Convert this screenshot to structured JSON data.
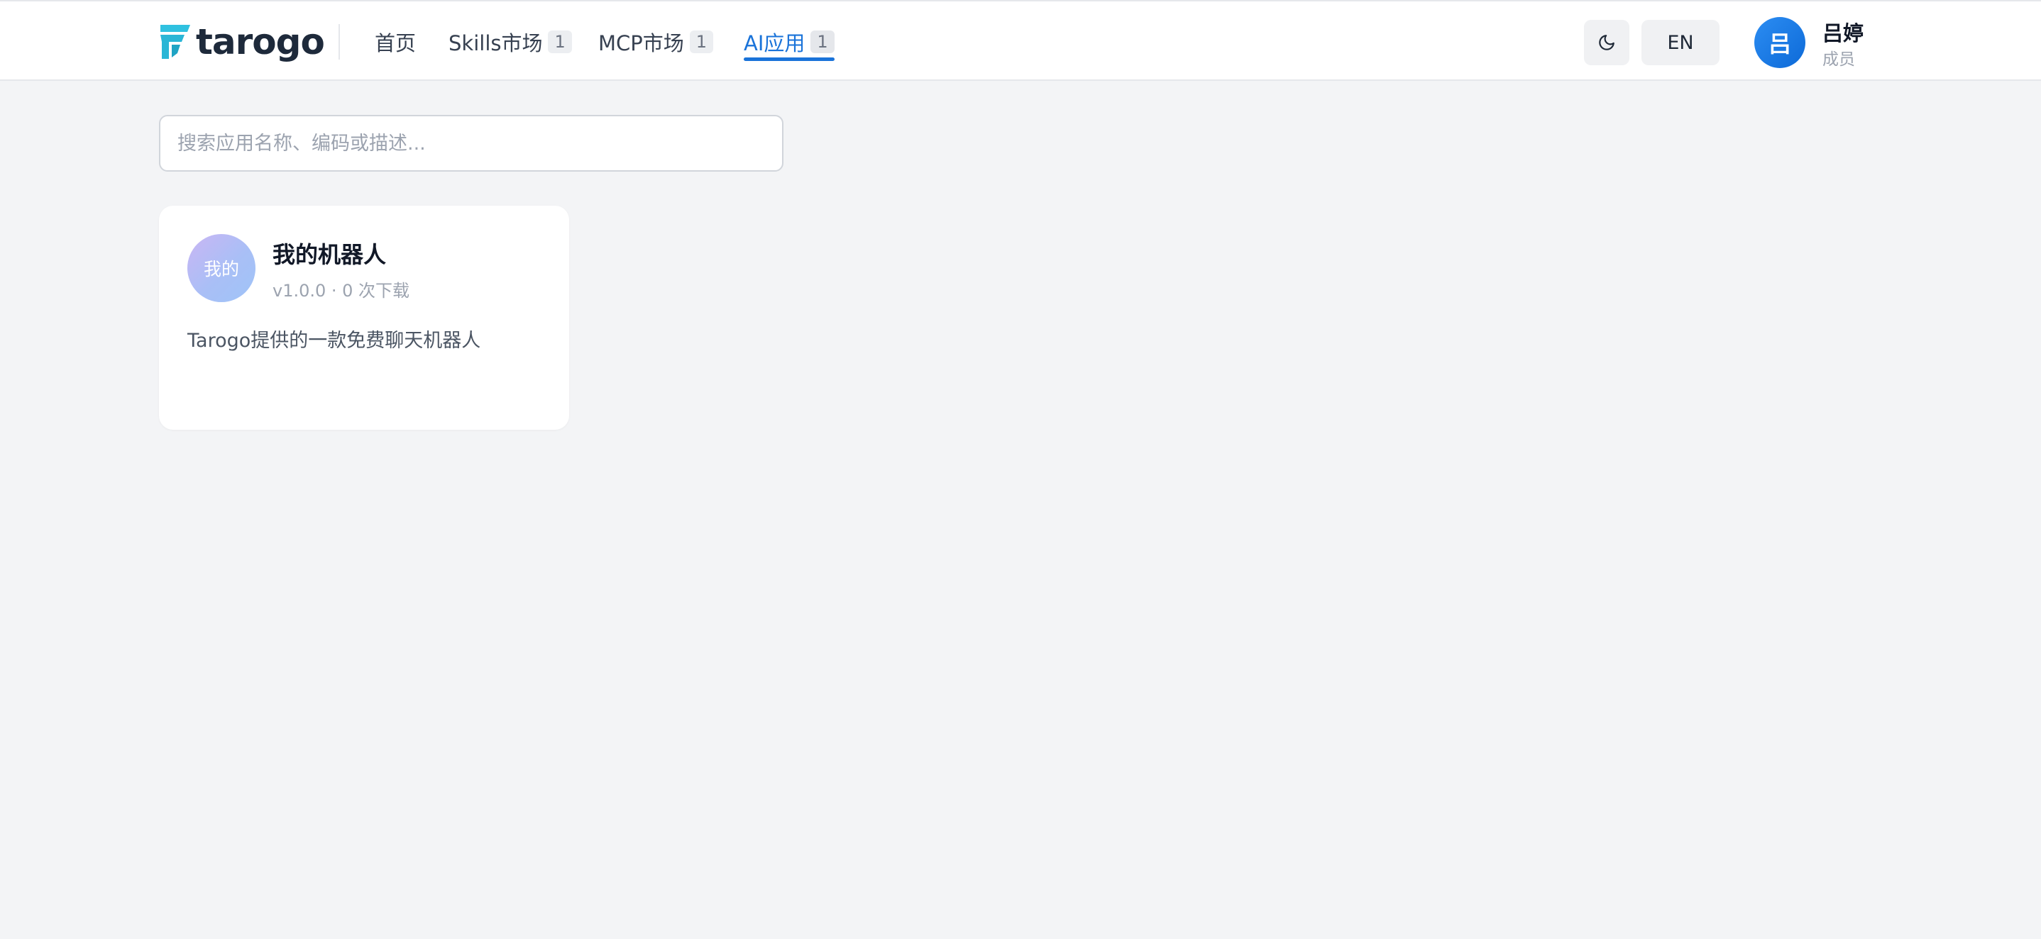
{
  "header": {
    "logo_text": "tarogo",
    "nav": [
      {
        "label": "首页",
        "count": null
      },
      {
        "label": "Skills市场",
        "count": "1"
      },
      {
        "label": "MCP市场",
        "count": "1"
      },
      {
        "label": "AI应用",
        "count": "1",
        "active": true
      }
    ],
    "theme_icon": "moon-icon",
    "lang_label": "EN",
    "user": {
      "avatar_text": "吕",
      "name": "吕婷",
      "role": "成员"
    }
  },
  "search": {
    "placeholder": "搜索应用名称、编码或描述...",
    "value": ""
  },
  "apps": [
    {
      "avatar_text": "我的",
      "name": "我的机器人",
      "meta": "v1.0.0 · 0 次下载",
      "description": "Tarogo提供的一款免费聊天机器人"
    }
  ],
  "colors": {
    "accent": "#1a73d9",
    "page_bg": "#f3f4f6",
    "logo_mark": "#2fc1e0"
  }
}
